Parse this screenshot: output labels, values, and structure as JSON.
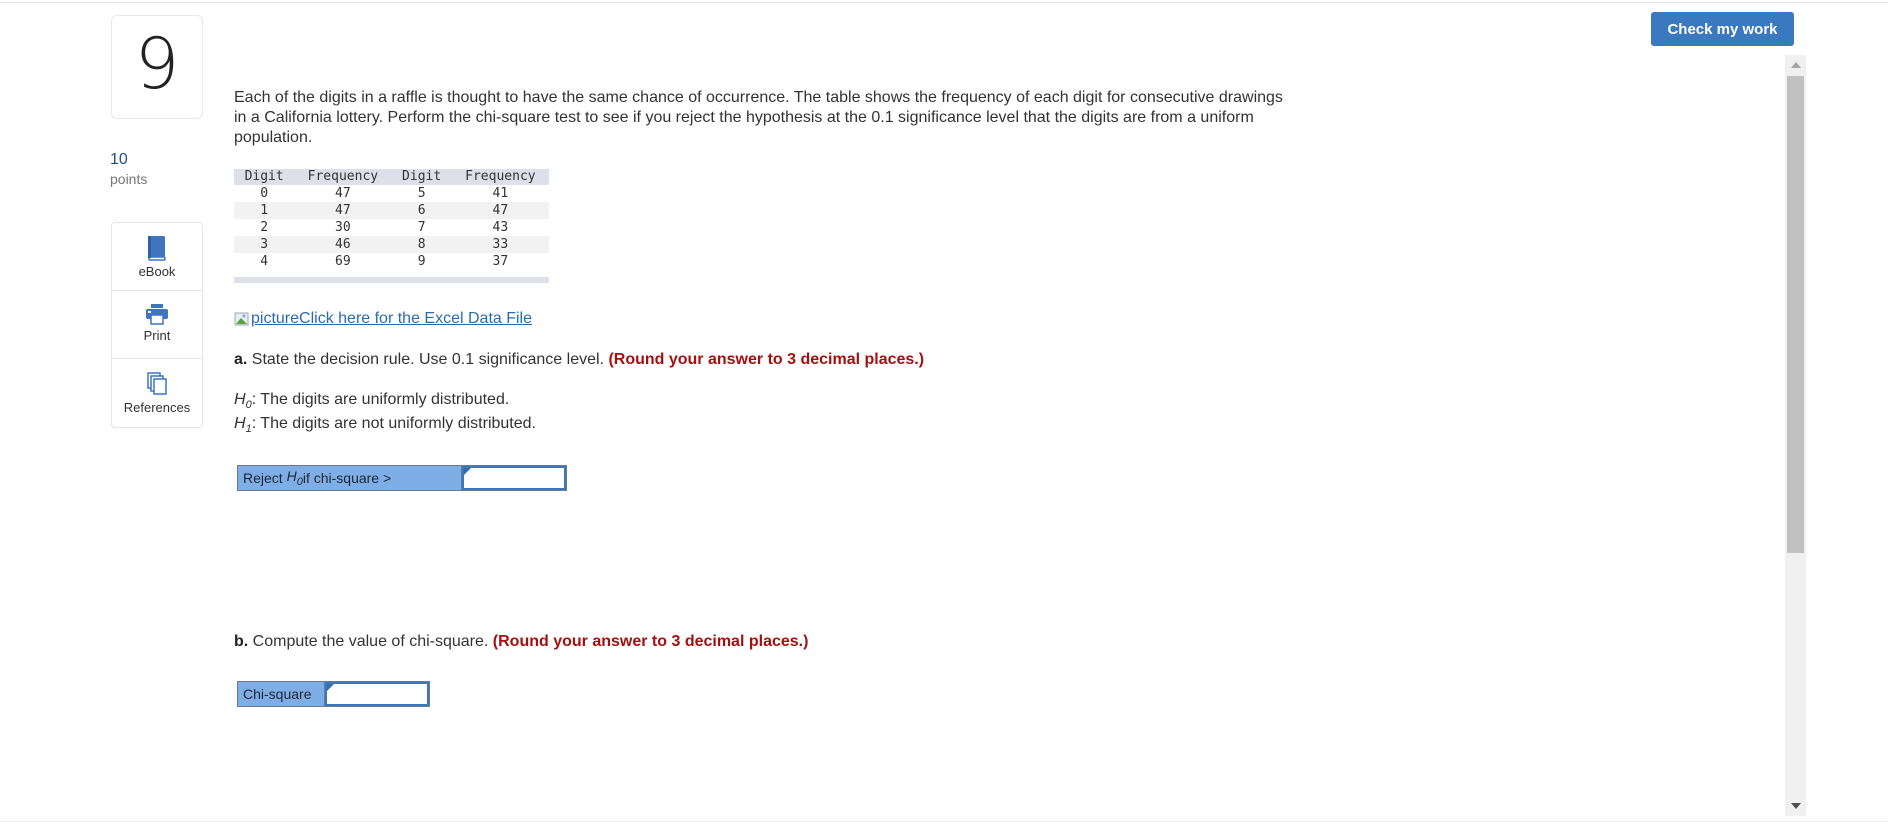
{
  "question": {
    "number": "9",
    "points_value": "10",
    "points_label": "points",
    "text": "Each of the digits in a raffle is thought to have the same chance of occurrence. The table shows the frequency of each digit for consecutive drawings in a California lottery. Perform the chi-square test to see if you reject the hypothesis at the 0.1 significance level that the digits are from a uniform population."
  },
  "tools": [
    {
      "label": "eBook",
      "icon": "book-icon"
    },
    {
      "label": "Print",
      "icon": "printer-icon"
    },
    {
      "label": "References",
      "icon": "references-icon"
    }
  ],
  "header": {
    "check_button_label": "Check my work"
  },
  "table": {
    "headers": [
      "Digit",
      "Frequency",
      "Digit",
      "Frequency"
    ],
    "rows": [
      [
        "0",
        "47",
        "5",
        "41"
      ],
      [
        "1",
        "47",
        "6",
        "47"
      ],
      [
        "2",
        "30",
        "7",
        "43"
      ],
      [
        "3",
        "46",
        "8",
        "33"
      ],
      [
        "4",
        "69",
        "9",
        "37"
      ]
    ]
  },
  "excel_link": {
    "alt_text": "picture",
    "label": " Click here for the Excel Data File"
  },
  "part_a": {
    "lead": "a.",
    "text": " State the decision rule. Use 0.1 significance level. ",
    "hint": "(Round your answer to 3 decimal places.)",
    "h0_symbol": "H",
    "h0_sub": "0",
    "h0_text": ": The digits are uniformly distributed.",
    "h1_symbol": "H",
    "h1_sub": "1",
    "h1_text": ": The digits are not uniformly distributed.",
    "answer_label_pre": "Reject ",
    "answer_label_sym": "H",
    "answer_label_sub": "0",
    "answer_label_post": " if chi-square >",
    "answer_value": ""
  },
  "part_b": {
    "lead": "b.",
    "text": " Compute the value of chi-square. ",
    "hint": "(Round your answer to 3 decimal places.)",
    "answer_label": "Chi-square",
    "answer_value": ""
  },
  "colors": {
    "brand_button": "#3a78bf",
    "hint_red": "#a60f0f",
    "answer_label_bg": "#7eaee5",
    "link_blue": "#2b6cb0"
  }
}
